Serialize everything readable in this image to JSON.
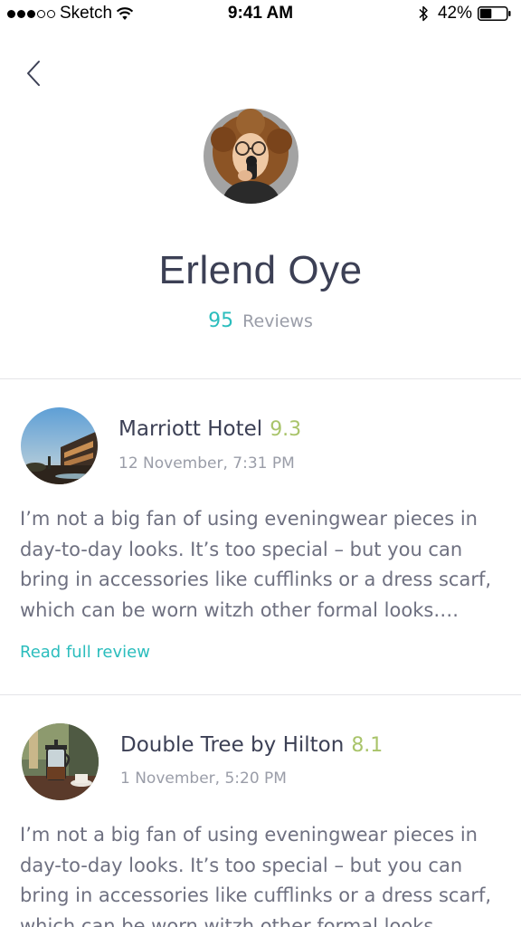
{
  "status_bar": {
    "carrier": "Sketch",
    "time": "9:41 AM",
    "battery": "42%"
  },
  "profile": {
    "name": "Erlend Oye",
    "review_count": "95",
    "reviews_label": "Reviews"
  },
  "reviews": [
    {
      "hotel": "Marriott Hotel",
      "score": "9.3",
      "date": "12 November, 7:31 PM",
      "text": "I’m not a big fan of using eveningwear pieces in day-to-day looks. It’s too special – but you can bring in accessories like cufflinks or a dress scarf, which can be worn witzh other formal looks….",
      "read_more": "Read full review"
    },
    {
      "hotel": "Double Tree by Hilton",
      "score": "8.1",
      "date": "1 November, 5:20 PM",
      "text": "I’m not a big fan of using eveningwear pieces in day-to-day looks. It’s too special – but you can bring in accessories like cufflinks or a dress scarf, which can be worn witzh other formal looks…."
    }
  ],
  "colors": {
    "accent": "#2bbdbd",
    "score": "#a9c46a",
    "heading": "#3c4055",
    "body_text": "#6e7080",
    "muted": "#9a9da8",
    "divider": "#e4e4e8"
  },
  "icons": {
    "back": "chevron-left-icon",
    "wifi": "wifi-icon",
    "bluetooth": "bluetooth-icon",
    "battery": "battery-icon"
  }
}
